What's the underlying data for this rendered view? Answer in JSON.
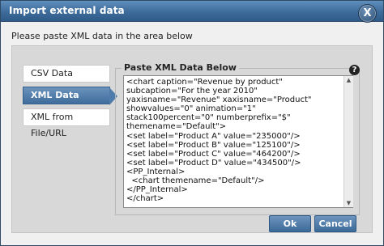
{
  "dialog": {
    "title": "Import external data",
    "close_glyph": "X",
    "instruction": "Please paste XML data in the area below"
  },
  "tabs": [
    {
      "label": "CSV Data"
    },
    {
      "label": "XML Data"
    },
    {
      "label": "XML from File/URL"
    }
  ],
  "active_tab": "XML Data",
  "xml_panel": {
    "legend": "Paste XML Data Below",
    "help_glyph": "?",
    "content": "<chart caption=\"Revenue by product\" subcaption=\"For the year 2010\" yaxisname=\"Revenue\" xaxisname=\"Product\" showvalues=\"0\" animation=\"1\" stack100percent=\"0\" numberprefix=\"$\" themename=\"Default\">\n<set label=\"Product A\" value=\"235000\"/>\n<set label=\"Product B\" value=\"125100\"/>\n<set label=\"Product C\" value=\"464200\"/>\n<set label=\"Product D\" value=\"434500\"/>\n<PP_Internal>\n  <chart themename=\"Default\"/>\n</PP_Internal>\n</chart>"
  },
  "buttons": {
    "ok": "Ok",
    "cancel": "Cancel"
  },
  "colors": {
    "titlebar": "#3d6b9a",
    "button": "#4f7caa",
    "panel": "#d8d8d8"
  },
  "icons": {
    "close": "close-icon",
    "help": "help-icon",
    "scroll_up": "scroll-up-arrow-icon",
    "scroll_down": "scroll-down-arrow-icon"
  }
}
